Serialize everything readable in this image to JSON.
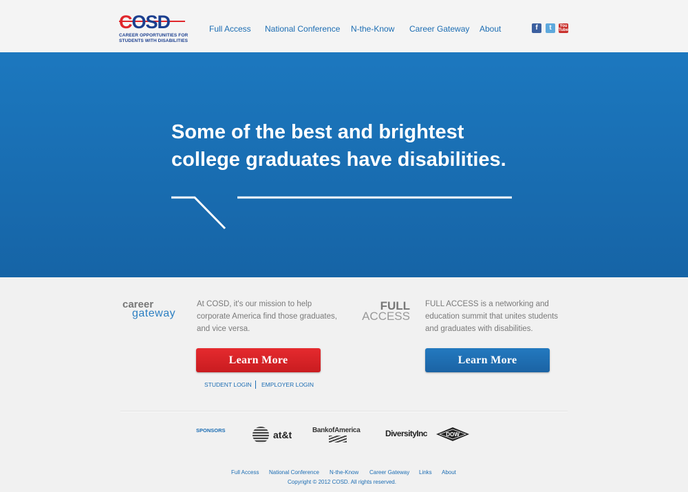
{
  "header": {
    "logo": {
      "mark_c": "C",
      "mark_rest": "OSD",
      "subtitle": "CAREER OPPORTUNITIES FOR\nSTUDENTS WITH DISABILITIES"
    },
    "nav": [
      "Full Access",
      "National Conference",
      "N-the-Know",
      "Career Gateway",
      "About"
    ],
    "social": [
      {
        "icon": "facebook-icon",
        "glyph": "f",
        "color": "#3b5f9f"
      },
      {
        "icon": "twitter-icon",
        "glyph": "t",
        "color": "#5ea9dd"
      },
      {
        "icon": "youtube-icon",
        "glyph": "You\nTube",
        "color": "#c9302c"
      }
    ]
  },
  "hero": {
    "headline": "Some of the best and brightest\ncollege graduates have disabilities.",
    "background": "#1c78bf"
  },
  "career_gateway": {
    "logo_top": "career",
    "logo_bottom": "gateway",
    "description": "At COSD, it's our mission to help corporate America find those graduates, and vice versa.",
    "button": "Learn More",
    "button_color": "#e52a2e",
    "logins": [
      "STUDENT LOGIN",
      "EMPLOYER LOGIN"
    ]
  },
  "full_access": {
    "logo_top": "FULL",
    "logo_bottom": "ACCESS",
    "description": "FULL ACCESS is a networking and education summit that unites students and graduates with disabilities.",
    "button": "Learn More",
    "button_color": "#1b6fb3"
  },
  "sponsors": {
    "label": "SPONSORS",
    "att": "at&t",
    "boa": "BankofAmerica",
    "diversity": "DiversityInc",
    "dow": "DOW"
  },
  "footer": {
    "nav": [
      "Full Access",
      "National Conference",
      "N-the-Know",
      "Career Gateway",
      "Links",
      "About"
    ],
    "copyright": "Copyright © 2012 COSD. All rights reserved."
  },
  "colors": {
    "accent_blue": "#1c6db3",
    "brand_red": "#e0262b",
    "brand_navy": "#1b3f8f"
  }
}
